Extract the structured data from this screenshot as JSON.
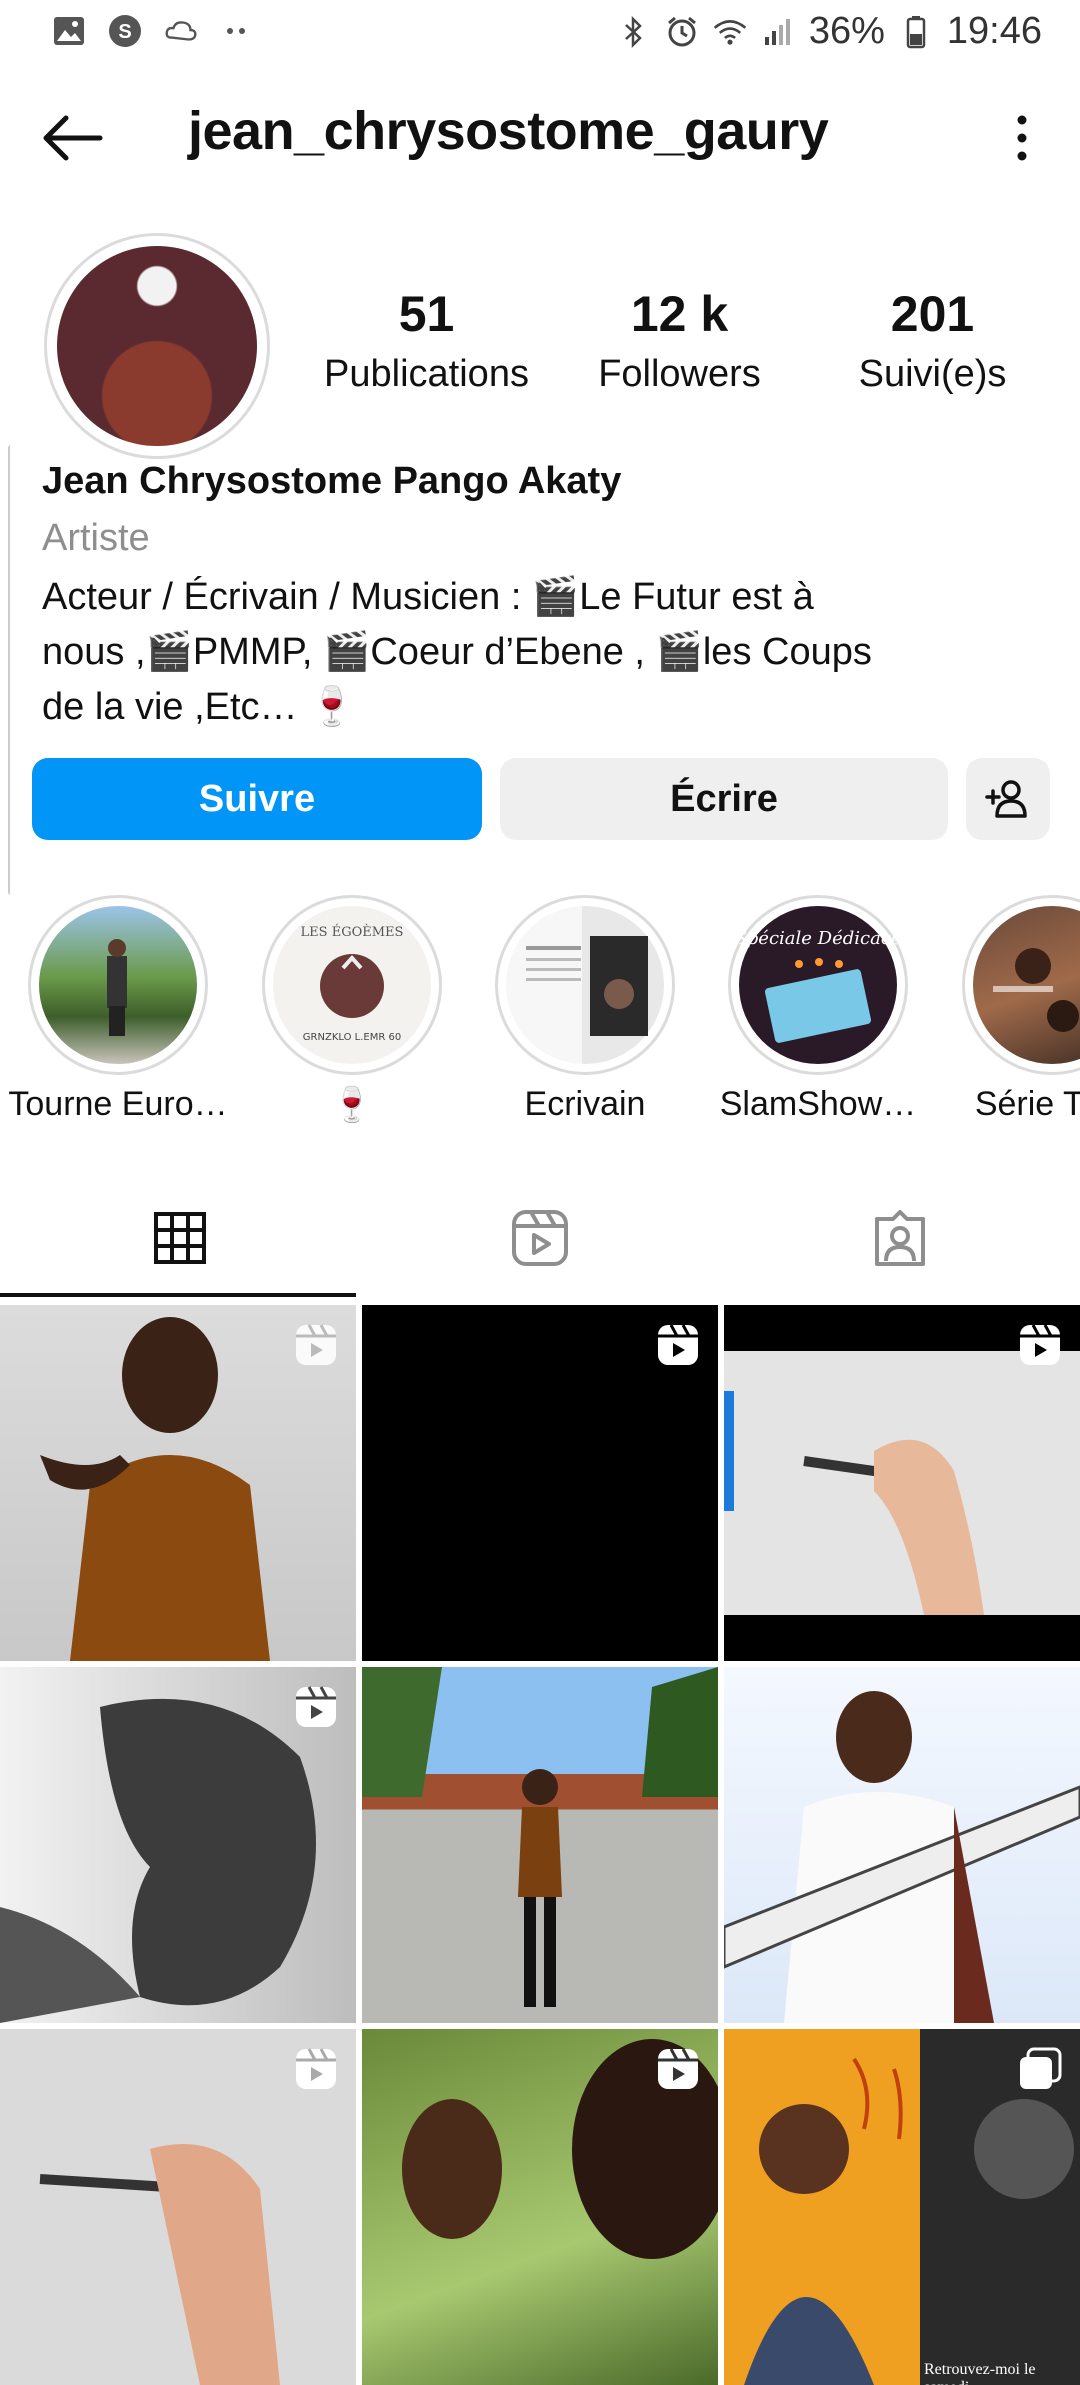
{
  "status_bar": {
    "battery": "36%",
    "time": "19:46",
    "left_icons": [
      "gallery-icon",
      "s-app-icon",
      "weather-icon",
      "more-dots-icon"
    ],
    "right_icons": [
      "bluetooth-icon",
      "alarm-icon",
      "wifi-icon",
      "signal-icon",
      "battery-icon"
    ]
  },
  "header": {
    "username": "jean_chrysostome_gaury"
  },
  "stats": [
    {
      "value": "51",
      "label": "Publications"
    },
    {
      "value": "12 k",
      "label": "Followers"
    },
    {
      "value": "201",
      "label": "Suivi(e)s"
    }
  ],
  "bio": {
    "name": "Jean Chrysostome Pango Akaty",
    "category": "Artiste",
    "text": "Acteur / Écrivain / Musicien : 🎬Le Futur est à\nnous ,🎬PMMP, 🎬Coeur d’Ebene , 🎬les Coups\nde la vie ,Etc… 🍷"
  },
  "actions": {
    "follow": "Suivre",
    "message": "Écrire"
  },
  "highlights": [
    {
      "label": "Tourne Euro…"
    },
    {
      "label": "🍷"
    },
    {
      "label": "Ecrivain"
    },
    {
      "label": "SlamShow…"
    },
    {
      "label": "Série Télé"
    }
  ],
  "highlight_images": {
    "h2_text_top": "LES ÉGOÈMES",
    "h2_text_bottom": "GRNZKLO L.EMR 60",
    "h4_text": "Spéciale Dédicace"
  },
  "post_caption_9": "Retrouvez-moi le samedi",
  "colors": {
    "follow_button": "#0095f6",
    "secondary_button": "#efefef"
  }
}
